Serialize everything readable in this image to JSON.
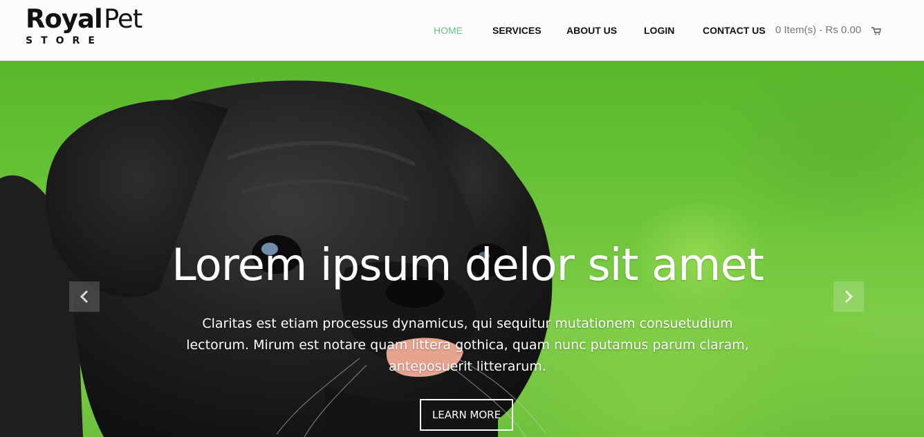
{
  "brand": {
    "word_bold": "Royal",
    "word_light": "Pet",
    "tagline": "STORE"
  },
  "nav": {
    "items": [
      {
        "label": "HOME",
        "active": true
      },
      {
        "label": "SERVICES",
        "active": false
      },
      {
        "label": "ABOUT US",
        "active": false
      },
      {
        "label": "LOGIN",
        "active": false
      },
      {
        "label": "CONTACT US",
        "active": false
      }
    ]
  },
  "cart": {
    "summary": "0 Item(s) - Rs 0.00",
    "icon": "cart-icon"
  },
  "hero": {
    "title": "Lorem ipsum delor sit amet",
    "text": "Claritas est etiam processus dynamicus, qui sequitur mutationem consuetudium lectorum. Mirum est notare quam littera gothica, quam nunc putamus parum claram, anteposuerit litterarum.",
    "button_label": "LEARN MORE",
    "prev_icon": "chevron-left-icon",
    "next_icon": "chevron-right-icon"
  },
  "colors": {
    "accent": "#5fc480",
    "nav_text": "#111111",
    "cart_text": "#777777",
    "hero_text": "#ffffff"
  }
}
